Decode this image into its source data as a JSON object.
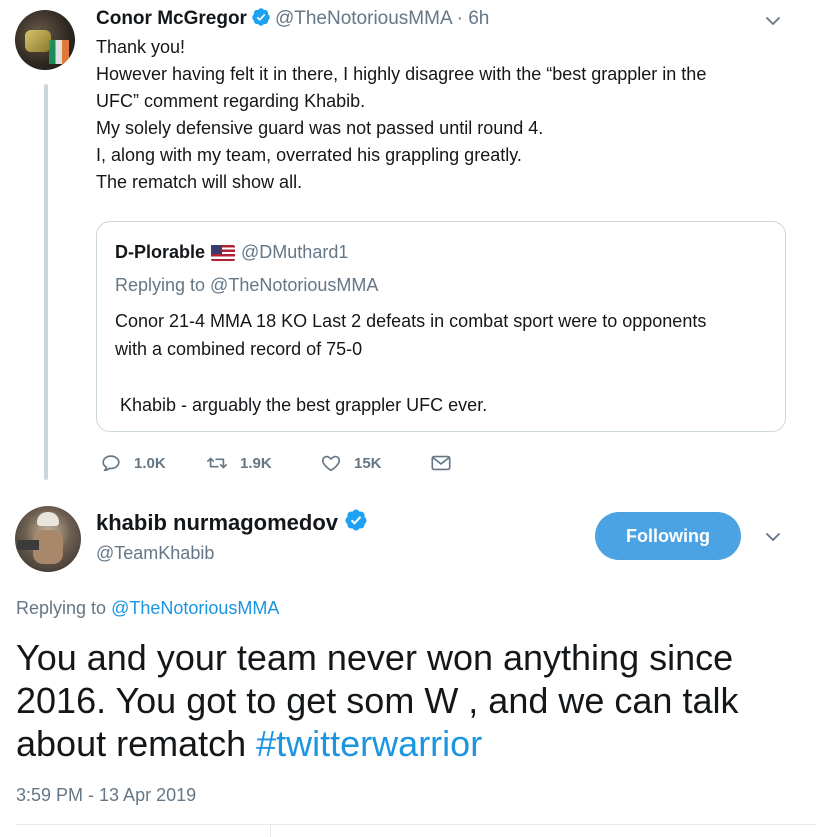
{
  "colors": {
    "accent": "#1b95e0",
    "follow_bg": "#4ba3e3",
    "muted": "#657786",
    "border": "#ccd6dd"
  },
  "tweet1": {
    "name": "Conor McGregor",
    "handle": "@TheNotoriousMMA",
    "time": "· 6h",
    "verified_icon": "verified-badge-icon",
    "lines": [
      "Thank you!",
      "However having felt it in there, I highly disagree with the “best grappler in the",
      "UFC” comment regarding Khabib.",
      "My solely defensive guard was not passed until round 4.",
      "I, along with my team, overrated his grappling greatly.",
      "The rematch will show all."
    ],
    "quote": {
      "name": "D-Plorable",
      "flag_icon": "us-flag-icon",
      "handle": "@DMuthard1",
      "replying": "Replying to @TheNotoriousMMA",
      "line1": "Conor 21-4 MMA 18 KO  Last 2 defeats in combat sport were to opponents",
      "line2": "with a combined record of 75-0",
      "line3": " Khabib - arguably the best grappler UFC ever."
    },
    "actions": {
      "replies": "1.0K",
      "retweets": "1.9K",
      "likes": "15K"
    }
  },
  "tweet2": {
    "name": "khabib nurmagomedov",
    "handle": "@TeamKhabib",
    "follow_label": "Following",
    "replying_prefix": "Replying to ",
    "replying_handle": "@TheNotoriousMMA",
    "text_line1": "You and your team never won anything since",
    "text_line2": "2016. You got to get som W , and we can talk",
    "text_line3_prefix": "about rematch ",
    "hashtag": "#twitterwarrior",
    "timestamp": "3:59 PM - 13 Apr 2019"
  }
}
